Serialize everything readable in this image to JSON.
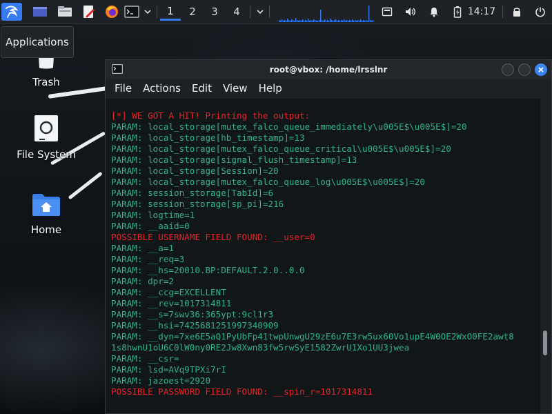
{
  "panel": {
    "workspaces": [
      "1",
      "2",
      "3",
      "4"
    ],
    "active_workspace": 0,
    "clock": "14:17",
    "launchers": [
      "kali-menu-icon",
      "workspace-switcher-icon",
      "file-manager-icon",
      "text-editor-icon",
      "firefox-icon",
      "terminal-icon"
    ],
    "tray": [
      "screenshot-icon",
      "volume-icon",
      "notifications-icon",
      "battery-icon",
      "lock-icon",
      "logout-icon"
    ]
  },
  "tooltip": {
    "text": "Applications"
  },
  "desktop": {
    "icons": [
      {
        "label": "Trash"
      },
      {
        "label": "File System"
      },
      {
        "label": "Home"
      }
    ]
  },
  "terminal": {
    "title": "root@vbox: /home/lrsslnr",
    "menu": [
      "File",
      "Actions",
      "Edit",
      "View",
      "Help"
    ],
    "lines": [
      {
        "text": "[*] WE GOT A HIT! Printing the output:",
        "kind": "alert"
      },
      {
        "text": "PARAM: local_storage[mutex_falco_queue_immediately\\u005E$\\u005E$]=20",
        "kind": "param"
      },
      {
        "text": "PARAM: local_storage[hb_timestamp]=13",
        "kind": "param"
      },
      {
        "text": "PARAM: local_storage[mutex_falco_queue_critical\\u005E$\\u005E$]=20",
        "kind": "param"
      },
      {
        "text": "PARAM: local_storage[signal_flush_timestamp]=13",
        "kind": "param"
      },
      {
        "text": "PARAM: local_storage[Session]=20",
        "kind": "param"
      },
      {
        "text": "PARAM: local_storage[mutex_falco_queue_log\\u005E$\\u005E$]=20",
        "kind": "param"
      },
      {
        "text": "PARAM: session_storage[TabId]=6",
        "kind": "param"
      },
      {
        "text": "PARAM: session_storage[sp_pi]=216",
        "kind": "param"
      },
      {
        "text": "PARAM: logtime=1",
        "kind": "param"
      },
      {
        "text": "PARAM: __aaid=0",
        "kind": "param"
      },
      {
        "text": "POSSIBLE USERNAME FIELD FOUND: __user=0",
        "kind": "alert"
      },
      {
        "text": "PARAM: __a=1",
        "kind": "param"
      },
      {
        "text": "PARAM: __req=3",
        "kind": "param"
      },
      {
        "text": "PARAM: __hs=20010.BP:DEFAULT.2.0..0.0",
        "kind": "param"
      },
      {
        "text": "PARAM: dpr=2",
        "kind": "param"
      },
      {
        "text": "PARAM: __ccg=EXCELLENT",
        "kind": "param"
      },
      {
        "text": "PARAM: __rev=1017314811",
        "kind": "param"
      },
      {
        "text": "PARAM: __s=7swv36:365ypt:9cl1r3",
        "kind": "param"
      },
      {
        "text": "PARAM: __hsi=7425681251997340909",
        "kind": "param"
      },
      {
        "text": "PARAM: __dyn=7xe6E5aQ1PyUbFp41twpUnwgU29zE6u7E3rw5ux60Vo1upE4W0OE2WxO0FE2awt8",
        "kind": "param"
      },
      {
        "text": "1s8hwnU1oU6C0lW0ny0RE2Jw8Xwn83fw5rwSyE1582ZwrU1Xo1UU3jwea",
        "kind": "param"
      },
      {
        "text": "PARAM: __csr=",
        "kind": "param"
      },
      {
        "text": "PARAM: lsd=AVq9TPXi7rI",
        "kind": "param"
      },
      {
        "text": "PARAM: jazoest=2920",
        "kind": "param"
      },
      {
        "text": "POSSIBLE PASSWORD FIELD FOUND: __spin_r=1017314811",
        "kind": "alert"
      }
    ]
  },
  "colors": {
    "accent": "#367bf0",
    "param_text": "#2fb38a",
    "alert_text": "#e5252a"
  }
}
